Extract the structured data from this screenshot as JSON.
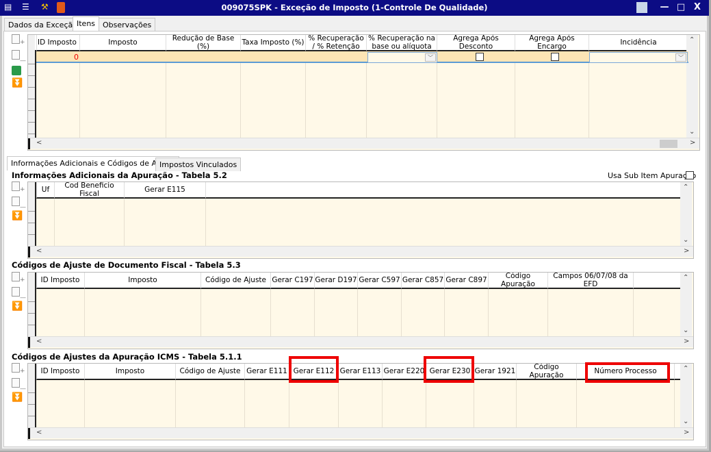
{
  "window": {
    "title": "009075SPK - Exceção de Imposto (1-Controle De Qualidade)",
    "buttons": {
      "minimize": "—",
      "maximize": "□",
      "close": "X"
    }
  },
  "tabs": [
    "Dados da Exceção",
    "Itens",
    "Observações"
  ],
  "items_grid": {
    "columns": [
      "ID Imposto",
      "Imposto",
      "Redução de Base (%)",
      "Taxa Imposto (%)",
      "% Recuperação / % Retenção",
      "% Recuperação na base ou alíquota",
      "Agrega Após Desconto",
      "Agrega Após Encargo",
      "Incidência"
    ],
    "row": {
      "id_imposto": "0"
    }
  },
  "sub_tabs": [
    "Informações Adicionais e Códigos de Ajuste",
    "Impostos Vinculados"
  ],
  "section1": {
    "title": "Informações Adicionais da Apuração - Tabela 5.2",
    "checkbox_label": "Usa Sub Item Apuração",
    "columns": [
      "Uf",
      "Cod Beneficio Fiscal",
      "Gerar E115"
    ]
  },
  "section2": {
    "title": "Códigos de Ajuste de Documento Fiscal - Tabela 5.3",
    "columns": [
      "ID Imposto",
      "Imposto",
      "Código de Ajuste",
      "Gerar C197",
      "Gerar D197",
      "Gerar C597",
      "Gerar C857",
      "Gerar C897",
      "Código Apuração",
      "Campos 06/07/08 da EFD"
    ]
  },
  "section3": {
    "title": "Códigos de Ajustes da Apuração ICMS - Tabela 5.1.1",
    "columns": [
      "ID Imposto",
      "Imposto",
      "Código de Ajuste",
      "Gerar E111",
      "Gerar E112",
      "Gerar E113",
      "Gerar E220",
      "Gerar E230",
      "Gerar 1921",
      "Código Apuração",
      "Número Processo"
    ]
  },
  "highlight_color": "#e00000"
}
